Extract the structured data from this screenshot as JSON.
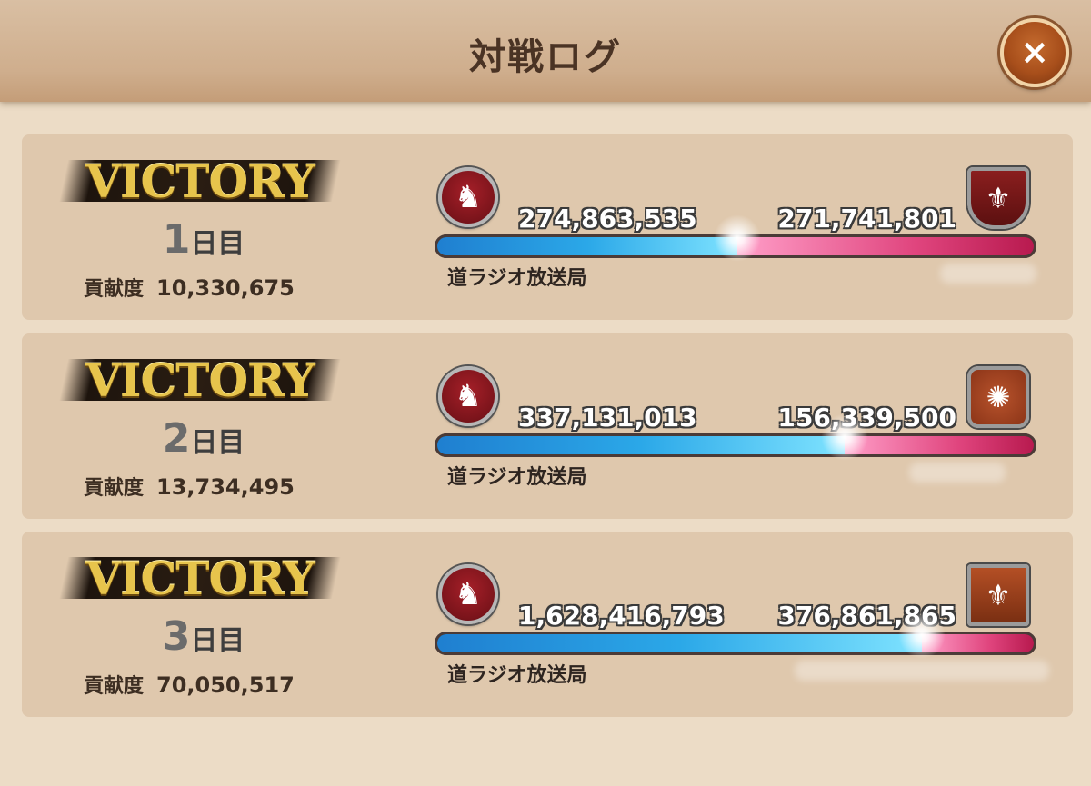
{
  "header": {
    "title": "対戦ログ",
    "close_label": "×"
  },
  "battles": [
    {
      "result": "VICTORY",
      "day_number": "1",
      "day_suffix": "日目",
      "contrib_label": "貢献度",
      "contrib_value": "10,330,675",
      "ally_score": "274,863,535",
      "enemy_score": "271,741,801",
      "ally_ratio": 0.5029,
      "ally_guild": "道ラジオ放送局",
      "ally_emblem": "horse-knight-icon",
      "enemy_emblem": "fleur-de-lis-shield-icon",
      "ally_color": "#2ba8e8",
      "enemy_color": "#e0457e"
    },
    {
      "result": "VICTORY",
      "day_number": "2",
      "day_suffix": "日目",
      "contrib_label": "貢献度",
      "contrib_value": "13,734,495",
      "ally_score": "337,131,013",
      "enemy_score": "156,339,500",
      "ally_ratio": 0.6832,
      "ally_guild": "道ラジオ放送局",
      "ally_emblem": "horse-knight-icon",
      "enemy_emblem": "tree-emblem-icon",
      "ally_color": "#2ba8e8",
      "enemy_color": "#e0457e"
    },
    {
      "result": "VICTORY",
      "day_number": "3",
      "day_suffix": "日目",
      "contrib_label": "貢献度",
      "contrib_value": "70,050,517",
      "ally_score": "1,628,416,793",
      "enemy_score": "376,861,865",
      "ally_ratio": 0.8121,
      "ally_guild": "道ラジオ放送局",
      "ally_emblem": "horse-knight-icon",
      "enemy_emblem": "fleur-de-lis-square-icon",
      "ally_color": "#2ba8e8",
      "enemy_color": "#e0457e"
    }
  ]
}
